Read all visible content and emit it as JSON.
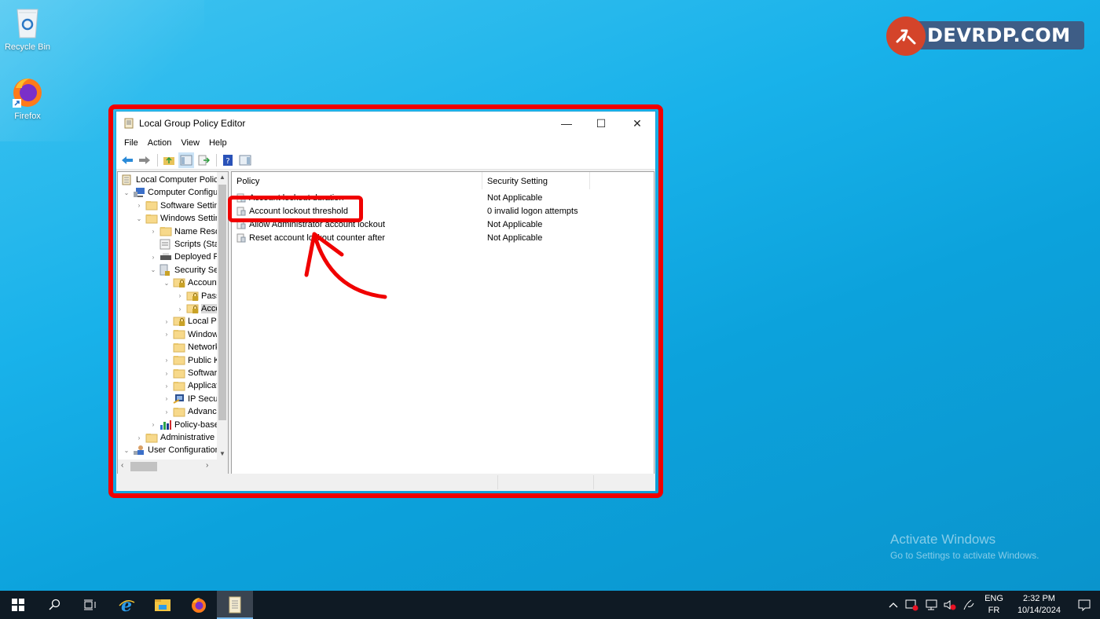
{
  "desktop": {
    "icons": [
      {
        "label": "Recycle Bin",
        "icon": "recycle-bin-icon"
      },
      {
        "label": "Firefox",
        "icon": "firefox-icon"
      }
    ],
    "logo_text": "DEVRDP.COM",
    "activation": {
      "title": "Activate Windows",
      "subtitle": "Go to Settings to activate Windows."
    }
  },
  "window": {
    "title": "Local Group Policy Editor",
    "controls": {
      "minimize": "—",
      "maximize": "☐",
      "close": "✕"
    },
    "menu": [
      "File",
      "Action",
      "View",
      "Help"
    ],
    "toolbar": [
      "back",
      "forward",
      "up-one-level",
      "show-hide-console-tree",
      "export-list",
      "help",
      "show-action-pane"
    ],
    "tree": [
      {
        "label": "Local Computer Policy",
        "level": 0,
        "expander": "",
        "icon": "policy-scroll-icon"
      },
      {
        "label": "Computer Configuration",
        "level": 1,
        "expander": "⌄",
        "icon": "computer-icon"
      },
      {
        "label": "Software Settings",
        "level": 2,
        "expander": "›",
        "icon": "folder-icon"
      },
      {
        "label": "Windows Settings",
        "level": 2,
        "expander": "⌄",
        "icon": "folder-icon"
      },
      {
        "label": "Name Resolution Policy",
        "level": 3,
        "expander": "›",
        "icon": "folder-icon"
      },
      {
        "label": "Scripts (Startup/Shutdown)",
        "level": 3,
        "expander": "",
        "icon": "script-icon"
      },
      {
        "label": "Deployed Printers",
        "level": 3,
        "expander": "›",
        "icon": "printer-icon"
      },
      {
        "label": "Security Settings",
        "level": 3,
        "expander": "⌄",
        "icon": "security-icon"
      },
      {
        "label": "Account Policies",
        "level": 4,
        "expander": "⌄",
        "icon": "locked-folder-icon"
      },
      {
        "label": "Password Policy",
        "level": 5,
        "expander": "›",
        "icon": "locked-folder-icon"
      },
      {
        "label": "Account Lockout Policy",
        "level": 5,
        "expander": "›",
        "icon": "locked-folder-icon",
        "selected": true
      },
      {
        "label": "Local Policies",
        "level": 4,
        "expander": "›",
        "icon": "locked-folder-icon"
      },
      {
        "label": "Windows Defender Firewall",
        "level": 4,
        "expander": "›",
        "icon": "folder-icon"
      },
      {
        "label": "Network List Manager Policies",
        "level": 4,
        "expander": "",
        "icon": "folder-icon"
      },
      {
        "label": "Public Key Policies",
        "level": 4,
        "expander": "›",
        "icon": "folder-icon"
      },
      {
        "label": "Software Restriction Policies",
        "level": 4,
        "expander": "›",
        "icon": "folder-icon"
      },
      {
        "label": "Application Control Policies",
        "level": 4,
        "expander": "›",
        "icon": "folder-icon"
      },
      {
        "label": "IP Security Policies",
        "level": 4,
        "expander": "›",
        "icon": "ip-security-icon"
      },
      {
        "label": "Advanced Audit Policy",
        "level": 4,
        "expander": "›",
        "icon": "folder-icon"
      },
      {
        "label": "Policy-based QoS",
        "level": 3,
        "expander": "›",
        "icon": "chart-icon"
      },
      {
        "label": "Administrative Templates",
        "level": 2,
        "expander": "›",
        "icon": "folder-icon"
      },
      {
        "label": "User Configuration",
        "level": 1,
        "expander": "⌄",
        "icon": "user-icon"
      }
    ],
    "list": {
      "columns": [
        "Policy",
        "Security Setting"
      ],
      "rows": [
        {
          "policy": "Account lockout duration",
          "setting": "Not Applicable"
        },
        {
          "policy": "Account lockout threshold",
          "setting": "0 invalid logon attempts"
        },
        {
          "policy": "Allow Administrator account lockout",
          "setting": "Not Applicable"
        },
        {
          "policy": "Reset account lockout counter after",
          "setting": "Not Applicable"
        }
      ]
    }
  },
  "taskbar": {
    "items": [
      "start",
      "search",
      "task-view",
      "internet-explorer",
      "file-explorer",
      "firefox",
      "group-policy-editor"
    ],
    "lang": {
      "line1": "ENG",
      "line2": "FR"
    },
    "clock": {
      "time": "2:32 PM",
      "date": "10/14/2024"
    }
  },
  "colors": {
    "annotation_red": "#f00000",
    "desktop_blue": "#19b2ea",
    "taskbar": "#0f1a24",
    "logo_bar": "#3e5d86",
    "logo_circle": "#d4442a"
  }
}
